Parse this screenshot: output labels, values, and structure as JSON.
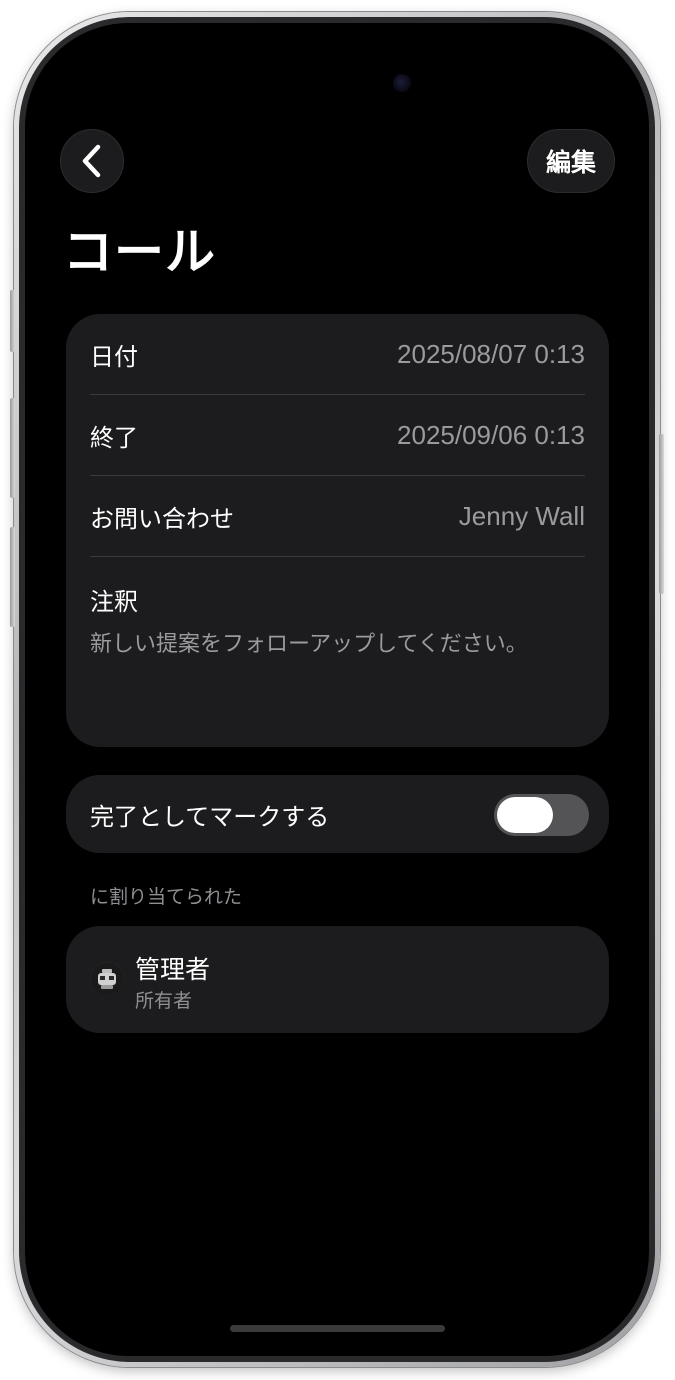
{
  "nav": {
    "back_icon": "chevron-left-icon",
    "edit_label": "編集"
  },
  "page_title": "コール",
  "details": {
    "rows": [
      {
        "label": "日付",
        "value": "2025/08/07 0:13"
      },
      {
        "label": "終了",
        "value": "2025/09/06 0:13"
      },
      {
        "label": "お問い合わせ",
        "value": "Jenny Wall"
      }
    ],
    "notes_label": "注釈",
    "notes_text": "新しい提案をフォローアップしてください。"
  },
  "completion": {
    "label": "完了としてマークする",
    "toggle_on": false
  },
  "assigned": {
    "section_header": "に割り当てられた",
    "name": "管理者",
    "role": "所有者"
  },
  "colors": {
    "background": "#000000",
    "card": "#1c1c1e",
    "primary_text": "#ffffff",
    "secondary_text": "#9a9a9f",
    "toggle_track_off": "#545456"
  }
}
